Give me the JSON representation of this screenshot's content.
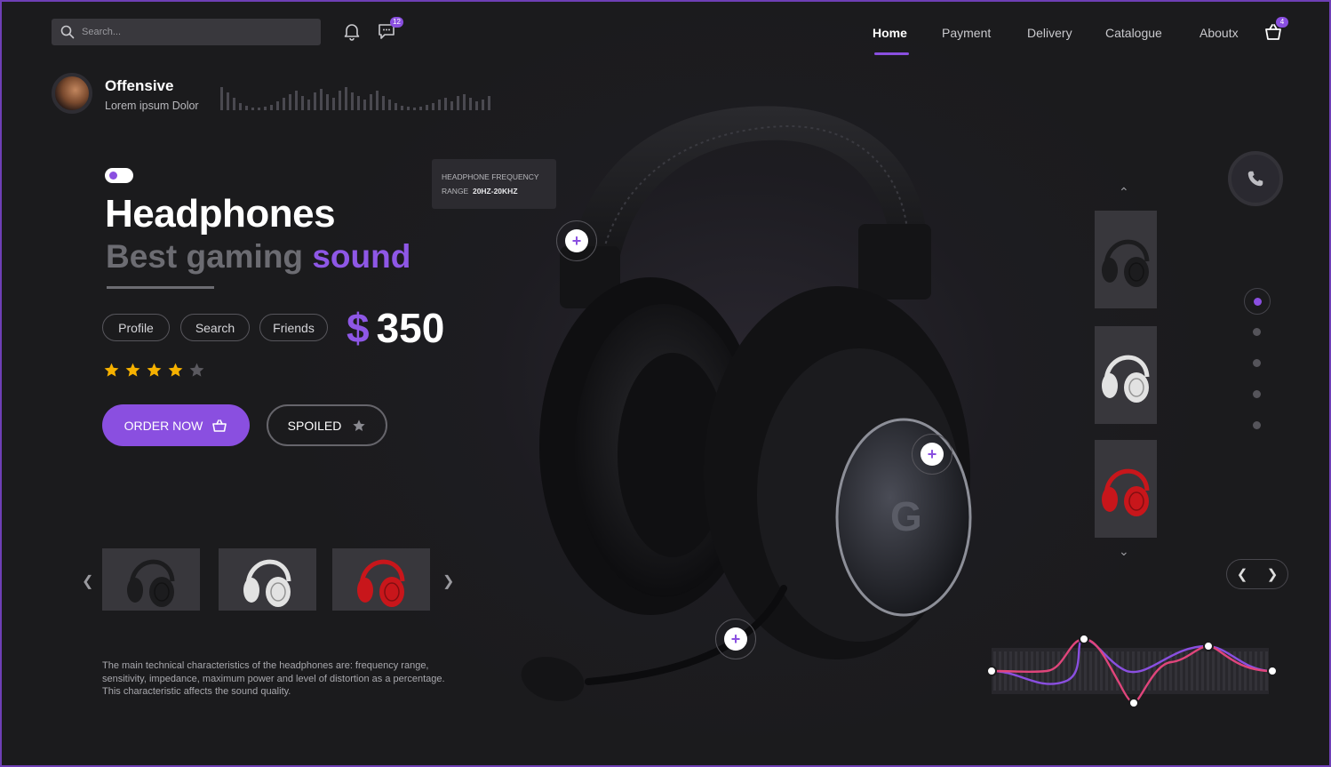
{
  "search": {
    "placeholder": "Search..."
  },
  "header": {
    "messages_badge": "12",
    "cart_badge": "4",
    "nav": [
      {
        "label": "Home",
        "active": true
      },
      {
        "label": "Payment"
      },
      {
        "label": "Delivery"
      },
      {
        "label": "Catalogue"
      },
      {
        "label": "Aboutx"
      }
    ]
  },
  "profile": {
    "name": "Offensive",
    "subtitle": "Lorem ipsum Dolor"
  },
  "hero": {
    "title": "Headphones",
    "subtitle_plain": "Best gaming",
    "subtitle_accent": "sound",
    "tags": [
      "Profile",
      "Search",
      "Friends"
    ],
    "currency": "$",
    "price": "350",
    "rating": 4,
    "rating_max": 5,
    "order_label": "ORDER NOW",
    "spoiled_label": "SPOILED"
  },
  "tooltip": {
    "line1": "HEADPHONE FREQUENCY",
    "range_label": "RANGE",
    "range_value": "20HZ-20KHZ"
  },
  "thumbnails": [
    {
      "name": "black-headphones",
      "color": "#1c1c1e"
    },
    {
      "name": "white-headphones",
      "color": "#e2e2e2"
    },
    {
      "name": "red-headphones",
      "color": "#c8161b"
    }
  ],
  "description": "The main technical characteristics of the headphones are: frequency range, sensitivity, impedance, maximum power and level of distortion as a percentage. This characteristic affects the sound quality.",
  "colors": {
    "accent": "#8a4fe0",
    "star": "#f6b100",
    "eq_pink": "#e0457b"
  }
}
